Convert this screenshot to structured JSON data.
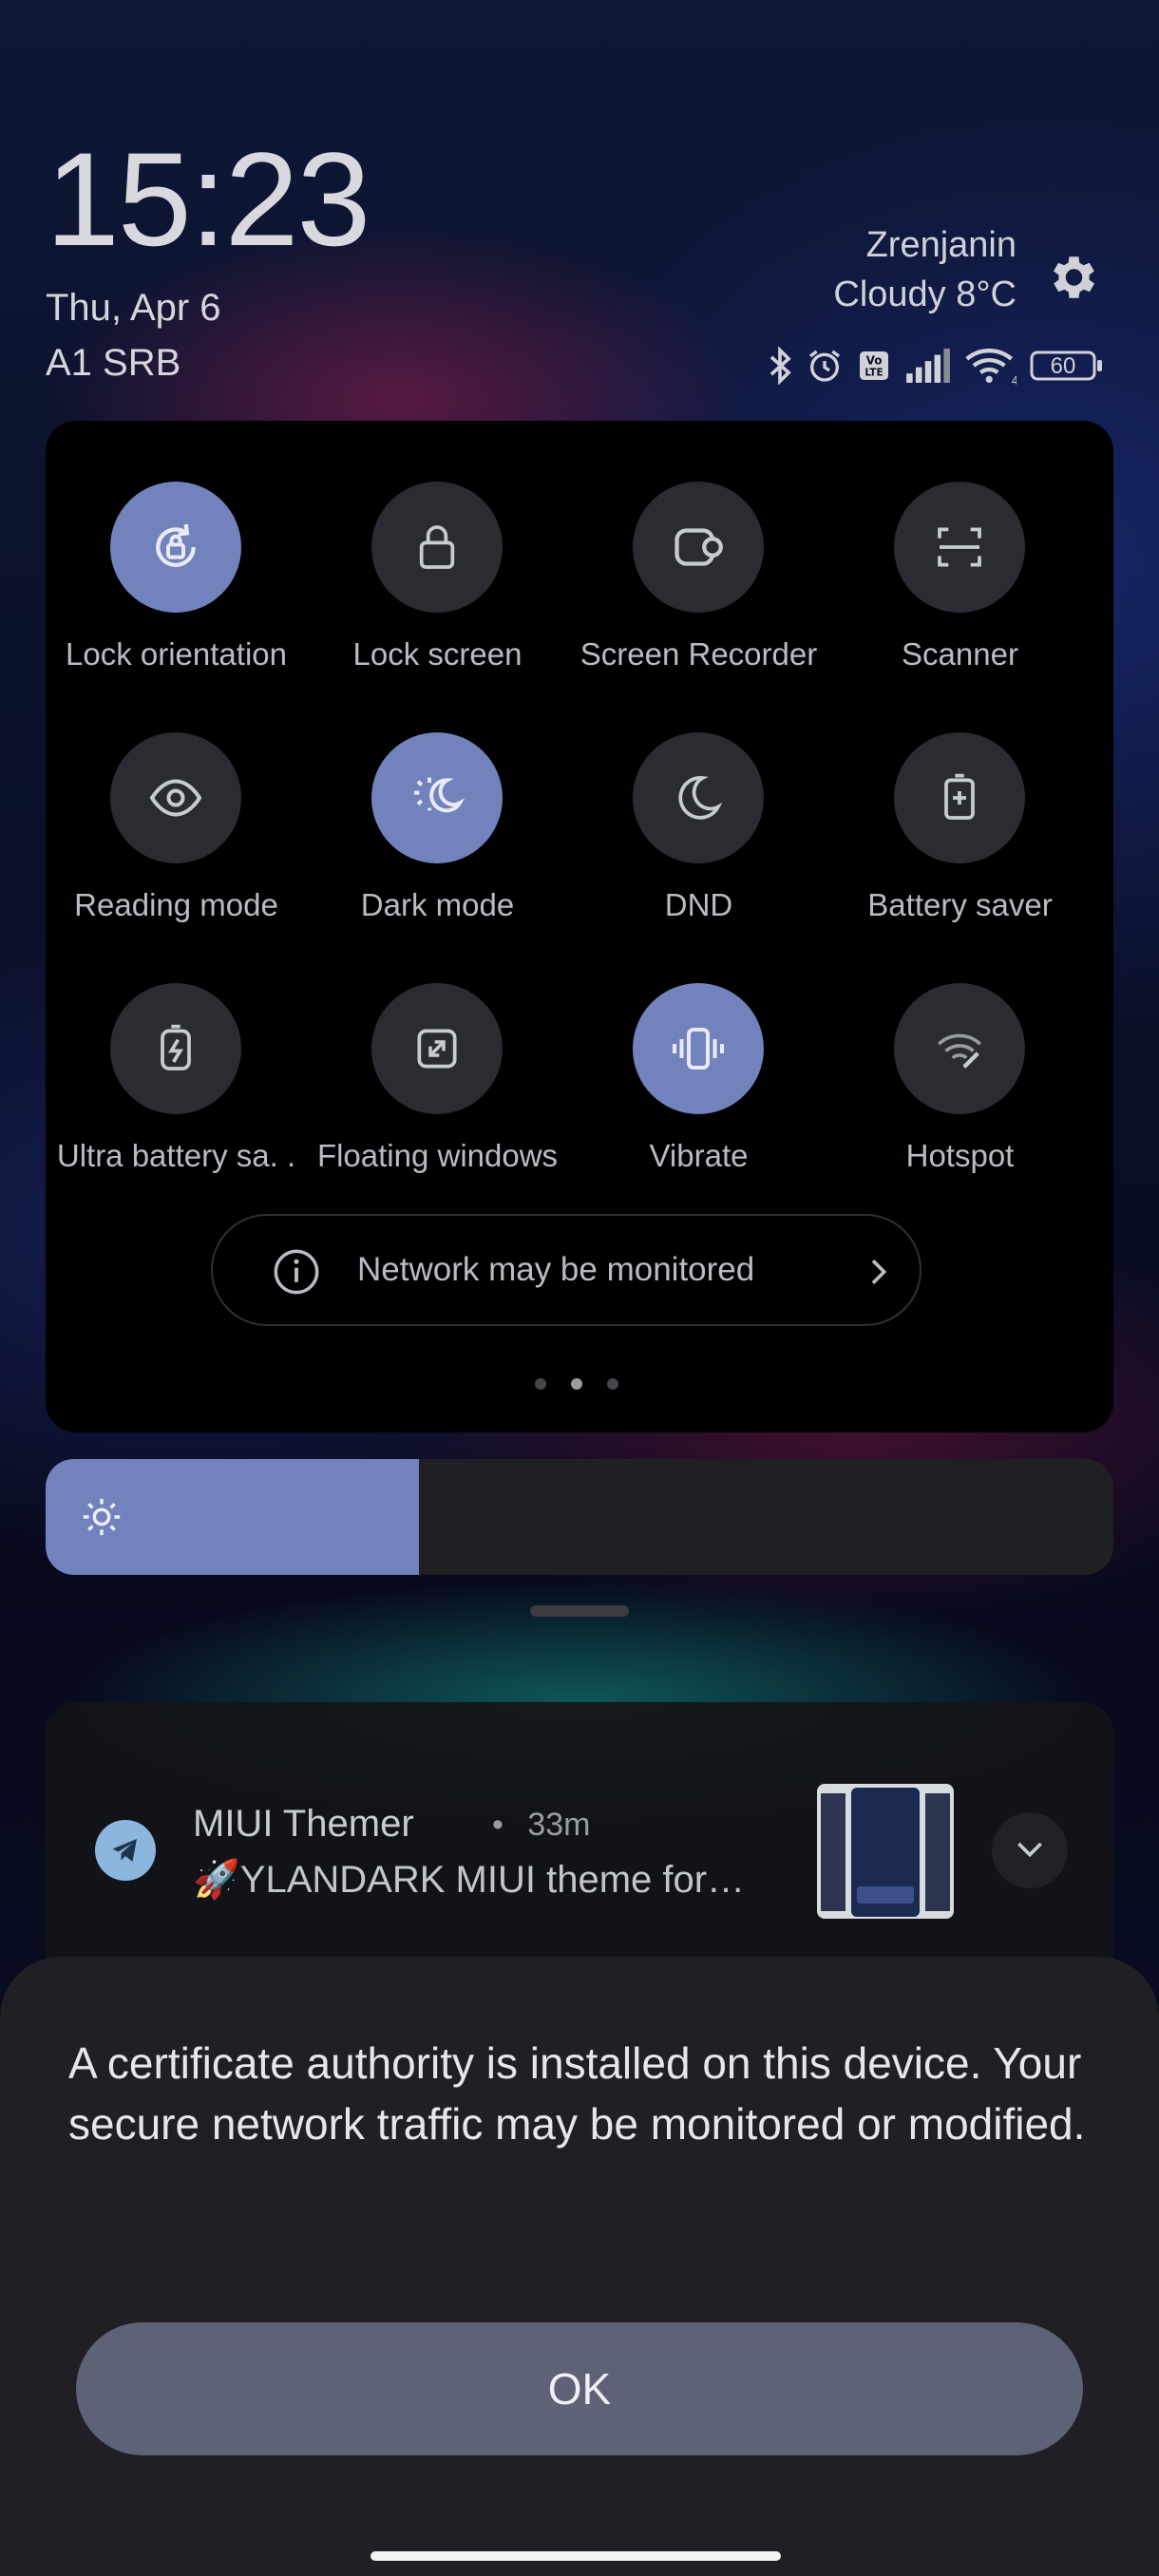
{
  "statusbar": {
    "time": "15:23",
    "date": "Thu, Apr 6",
    "carrier": "A1 SRB",
    "city": "Zrenjanin",
    "weather": "Cloudy 8°C",
    "battery": "60",
    "icons": [
      "bluetooth-icon",
      "alarm-icon",
      "volte-icon",
      "signal-icon",
      "wifi-icon",
      "battery-icon"
    ]
  },
  "quick_settings": {
    "tiles": [
      {
        "label": "Lock orientation",
        "icon": "rotation-lock-icon",
        "active": true
      },
      {
        "label": "Lock screen",
        "icon": "padlock-icon",
        "active": false
      },
      {
        "label": "Screen Recorder",
        "icon": "camera-recorder-icon",
        "active": false
      },
      {
        "label": "Scanner",
        "icon": "scan-frame-icon",
        "active": false
      },
      {
        "label": "Reading mode",
        "icon": "eye-icon",
        "active": false
      },
      {
        "label": "Dark mode",
        "icon": "sun-moon-icon",
        "active": true
      },
      {
        "label": "DND",
        "icon": "moon-icon",
        "active": false
      },
      {
        "label": "Battery saver",
        "icon": "battery-plus-icon",
        "active": false
      },
      {
        "label": "Ultra battery sa. .",
        "icon": "bolt-battery-icon",
        "active": false
      },
      {
        "label": "Floating windows",
        "icon": "floating-window-icon",
        "active": false
      },
      {
        "label": "Vibrate",
        "icon": "vibrate-icon",
        "active": true
      },
      {
        "label": "Hotspot",
        "icon": "hotspot-icon",
        "active": false
      }
    ],
    "network_notice": "Network may be monitored",
    "page_count": 3,
    "current_page": 2
  },
  "brightness": {
    "level": 0.35,
    "icon": "sun-icon"
  },
  "notification": {
    "app": "MIUI Themer",
    "separator": "•",
    "time": "33m",
    "body": "🚀YLANDARK MIUI theme for…"
  },
  "dialog": {
    "message": "A certificate authority is installed on this device. Your secure network traffic may be monitored or modified.",
    "ok_label": "OK"
  },
  "colors": {
    "accent": "#7282bd",
    "tile_inactive": "#2b2c31",
    "panel_bg": "#000000",
    "dialog_bg": "#1f1f25",
    "button_bg": "#5d6276"
  }
}
